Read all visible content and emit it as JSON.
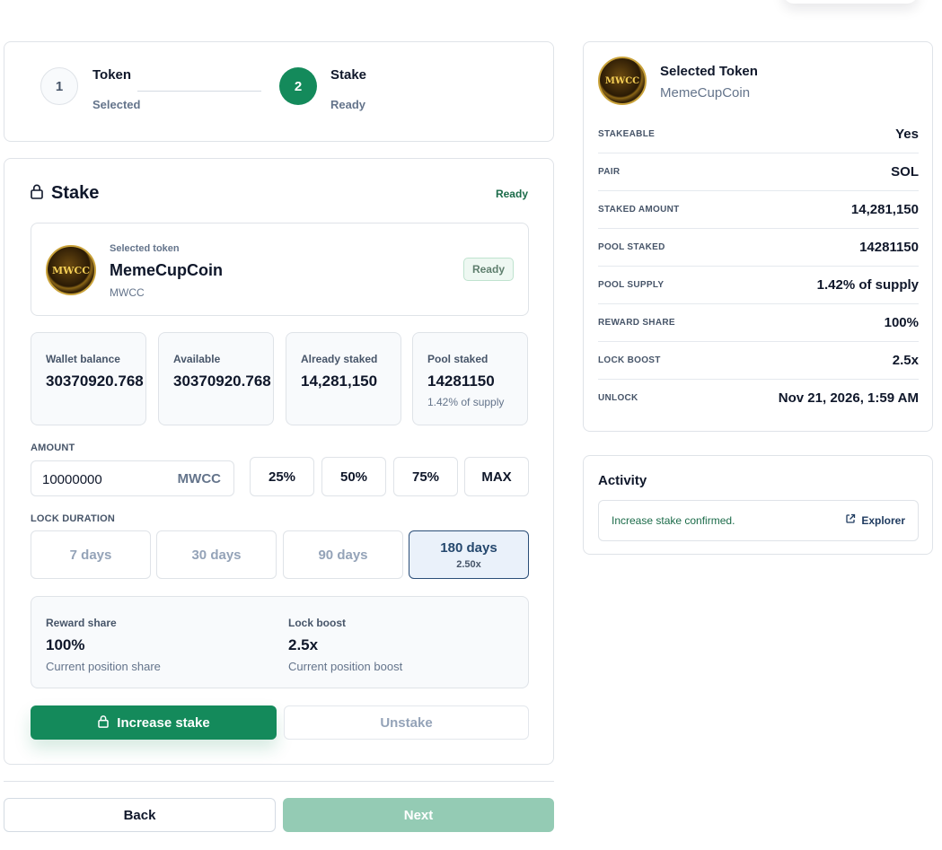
{
  "stepper": {
    "steps": [
      {
        "number": "1",
        "title": "Token",
        "status": "Selected"
      },
      {
        "number": "2",
        "title": "Stake",
        "status": "Ready"
      }
    ]
  },
  "stake": {
    "title": "Stake",
    "status": "Ready",
    "token": {
      "label": "Selected token",
      "name": "MemeCupCoin",
      "symbol": "MWCC",
      "badge": "Ready",
      "logo_text": "MWCC"
    },
    "stats": [
      {
        "label": "Wallet balance",
        "value": "30370920.768",
        "sub": ""
      },
      {
        "label": "Available",
        "value": "30370920.768",
        "sub": ""
      },
      {
        "label": "Already staked",
        "value": "14,281,150",
        "sub": ""
      },
      {
        "label": "Pool staked",
        "value": "14281150",
        "sub": "1.42% of supply"
      }
    ],
    "amount": {
      "label": "AMOUNT",
      "value": "10000000",
      "unit": "MWCC",
      "quick": [
        "25%",
        "50%",
        "75%",
        "MAX"
      ]
    },
    "lock": {
      "label": "LOCK DURATION",
      "options": [
        {
          "label": "7 days",
          "boost": ""
        },
        {
          "label": "30 days",
          "boost": ""
        },
        {
          "label": "90 days",
          "boost": ""
        },
        {
          "label": "180 days",
          "boost": "2.50x"
        }
      ],
      "selected": "180 days"
    },
    "summary": {
      "reward_label": "Reward share",
      "reward_value": "100%",
      "reward_sub": "Current position share",
      "boost_label": "Lock boost",
      "boost_value": "2.5x",
      "boost_sub": "Current position boost"
    },
    "increase_label": "Increase stake",
    "unstake_label": "Unstake"
  },
  "nav": {
    "back_label": "Back",
    "next_label": "Next"
  },
  "selected": {
    "title": "Selected Token",
    "name": "MemeCupCoin",
    "logo_text": "MWCC",
    "rows": [
      {
        "label": "STAKEABLE",
        "value": "Yes"
      },
      {
        "label": "PAIR",
        "value": "SOL"
      },
      {
        "label": "STAKED AMOUNT",
        "value": "14,281,150"
      },
      {
        "label": "POOL STAKED",
        "value": "14281150"
      },
      {
        "label": "POOL SUPPLY",
        "value": "1.42% of supply"
      },
      {
        "label": "REWARD SHARE",
        "value": "100%"
      },
      {
        "label": "LOCK BOOST",
        "value": "2.5x"
      },
      {
        "label": "UNLOCK",
        "value": "Nov 21, 2026, 1:59 AM"
      }
    ]
  },
  "activity": {
    "title": "Activity",
    "message": "Increase stake confirmed.",
    "link_label": "Explorer"
  },
  "colors": {
    "primary": "#148a5b",
    "primary_disabled": "#94cbb4",
    "active_outline": "#2b4e78",
    "success_text": "#1b6b49"
  }
}
